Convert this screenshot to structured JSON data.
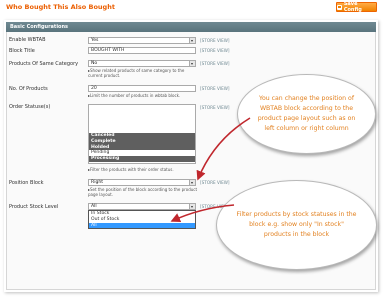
{
  "header": {
    "title": "Who Bought This Also Bought",
    "save_label": "Save Config"
  },
  "section": {
    "title": "Basic Configurations"
  },
  "fields": {
    "enable": {
      "label": "Enable WBTAB",
      "value": "Yes",
      "scope": "[STORE VIEW]"
    },
    "block_title": {
      "label": "Block Title",
      "value": "BOUGHT WITH",
      "scope": "[STORE VIEW]"
    },
    "same_category": {
      "label": "Products Of Same Category",
      "value": "No",
      "scope": "[STORE VIEW]",
      "note": "Show related products of same category to the current product."
    },
    "num_products": {
      "label": "No. Of Products",
      "value": "20",
      "scope": "[STORE VIEW]",
      "note": "Limit the number of products in wbtab block."
    },
    "order_status": {
      "label": "Order Statuse(s)",
      "scope": "[STORE VIEW]",
      "options": [
        "Canceled",
        "Complete",
        "Holded",
        "Pending",
        "Processing"
      ],
      "selected": [
        true,
        true,
        true,
        false,
        true
      ],
      "note": "Filter the products with their order status."
    },
    "position": {
      "label": "Position Block",
      "value": "Right",
      "scope": "[STORE VIEW]",
      "note": "Set the position of the block according to the product page layout."
    },
    "stock_level": {
      "label": "Product Stock Level",
      "value": "All",
      "scope": "[STORE VIEW]",
      "options": [
        "In Stock",
        "Out of Stock",
        "All"
      ]
    }
  },
  "callouts": {
    "position_tip": "You can change the position of WBTAB block according to the product page layout such as on left column or right column",
    "stock_tip": "Filter products by stock statuses in the block e.g. show only \"In stock\" products in the block"
  },
  "colors": {
    "title": "#eb5e00",
    "button": "#f18200",
    "section_bar": "#6f8992",
    "callout_text": "#e2801f",
    "arrow": "#c0272d"
  }
}
